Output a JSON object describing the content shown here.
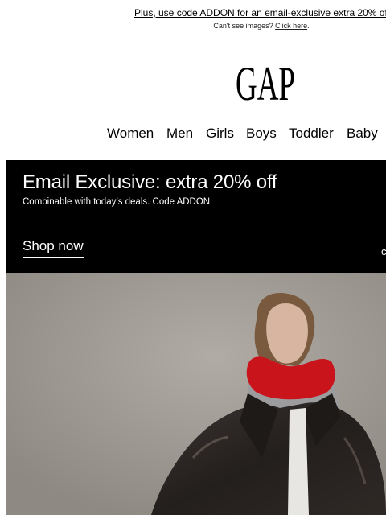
{
  "preheader": {
    "promo_text": "Plus, use code ADDON for an email-exclusive extra 20% of",
    "cant_see_text": "Can't see images?",
    "click_here": "Click here",
    "period": "."
  },
  "logo": {
    "text": "GAP"
  },
  "nav": {
    "items": [
      "Women",
      "Men",
      "Girls",
      "Boys",
      "Toddler",
      "Baby"
    ]
  },
  "banner": {
    "headline": "Email Exclusive: extra 20% off",
    "subtext": "Combinable with today’s deals. Code ADDON",
    "cta": "Shop now",
    "edge_char": "c"
  },
  "colors": {
    "banner_bg": "#000000",
    "hero_bg": "#a19d96",
    "scarf_red": "#c9141b",
    "jacket": "#2a2522"
  }
}
